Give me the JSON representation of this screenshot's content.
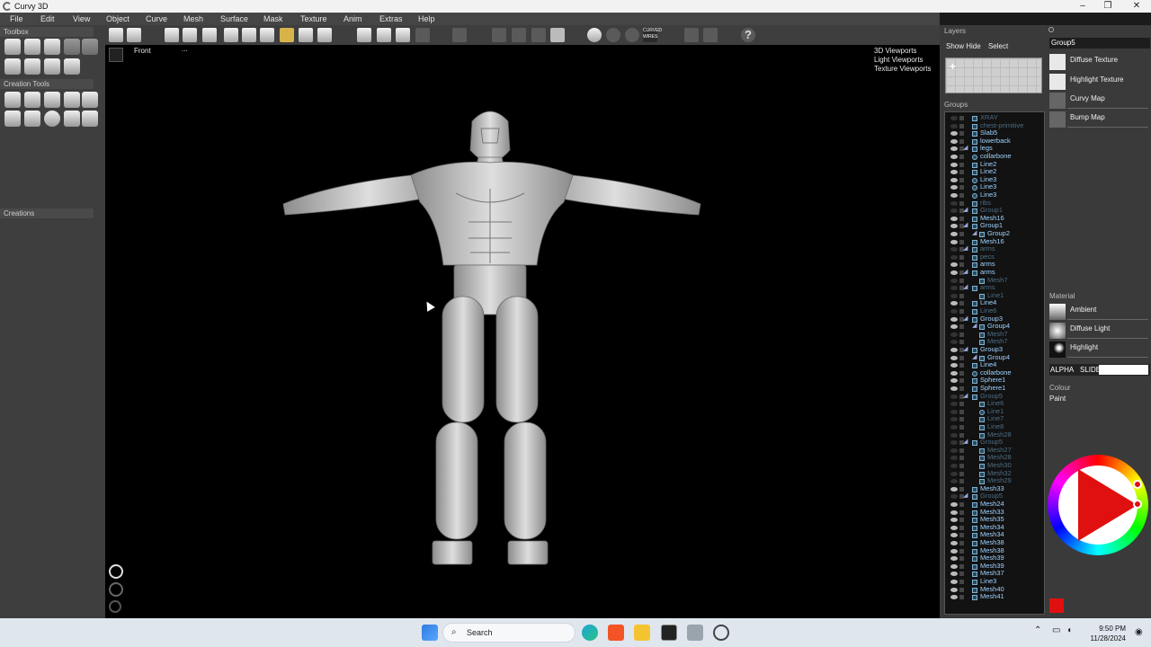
{
  "window": {
    "title": "Curvy 3D",
    "controls": [
      "–",
      "❐",
      "✕"
    ]
  },
  "menu": [
    "File",
    "Edit",
    "View",
    "Object",
    "Curve",
    "Mesh",
    "Surface",
    "Mask",
    "Texture",
    "Anim",
    "Extras",
    "Help"
  ],
  "left_panel": {
    "toolbox": "Toolbox",
    "creation_tools": "Creation Tools",
    "creations": "Creations"
  },
  "toolbar": {
    "curved_wires": "CURVED WIRES",
    "help": "?"
  },
  "viewport": {
    "name": "Front",
    "dots": "...",
    "links": [
      "3D Viewports",
      "Light Viewports",
      "Texture Viewports"
    ]
  },
  "layers": {
    "title": "Layers",
    "show": "Show",
    "hide": "Hide",
    "select": "Select",
    "groups_label": "Groups",
    "rows": [
      {
        "label": "XRAY",
        "visible": false,
        "indent": 1,
        "kind": "mesh"
      },
      {
        "label": "chest-primitive",
        "visible": false,
        "indent": 1,
        "kind": "mesh"
      },
      {
        "label": "Slab5",
        "visible": true,
        "indent": 1,
        "kind": "mesh"
      },
      {
        "label": "lowerback",
        "visible": true,
        "indent": 1,
        "kind": "mesh"
      },
      {
        "label": "legs",
        "visible": true,
        "indent": 1,
        "kind": "group"
      },
      {
        "label": "collarbone",
        "visible": true,
        "indent": 1,
        "kind": "line"
      },
      {
        "label": "Line2",
        "visible": true,
        "indent": 1,
        "kind": "mesh"
      },
      {
        "label": "Line2",
        "visible": true,
        "indent": 1,
        "kind": "mesh"
      },
      {
        "label": "Line3",
        "visible": true,
        "indent": 1,
        "kind": "line"
      },
      {
        "label": "Line3",
        "visible": true,
        "indent": 1,
        "kind": "line"
      },
      {
        "label": "Line3",
        "visible": true,
        "indent": 1,
        "kind": "line"
      },
      {
        "label": "ribs",
        "visible": false,
        "indent": 1,
        "kind": "mesh"
      },
      {
        "label": "Group1",
        "visible": false,
        "indent": 1,
        "kind": "group"
      },
      {
        "label": "Mesh16",
        "visible": true,
        "indent": 1,
        "kind": "mesh"
      },
      {
        "label": "Group1",
        "visible": true,
        "indent": 1,
        "kind": "group"
      },
      {
        "label": "Group2",
        "visible": true,
        "indent": 2,
        "kind": "group"
      },
      {
        "label": "Mesh16",
        "visible": true,
        "indent": 1,
        "kind": "mesh"
      },
      {
        "label": "arms",
        "visible": false,
        "indent": 1,
        "kind": "group"
      },
      {
        "label": "pecs",
        "visible": false,
        "indent": 1,
        "kind": "mesh"
      },
      {
        "label": "arms",
        "visible": true,
        "indent": 1,
        "kind": "mesh"
      },
      {
        "label": "arms",
        "visible": true,
        "indent": 1,
        "kind": "group"
      },
      {
        "label": "Mesh7",
        "visible": false,
        "indent": 2,
        "kind": "mesh"
      },
      {
        "label": "arms",
        "visible": false,
        "indent": 1,
        "kind": "group"
      },
      {
        "label": "Line1",
        "visible": false,
        "indent": 2,
        "kind": "mesh"
      },
      {
        "label": "Line4",
        "visible": true,
        "indent": 1,
        "kind": "mesh"
      },
      {
        "label": "Line6",
        "visible": false,
        "indent": 1,
        "kind": "mesh"
      },
      {
        "label": "Group3",
        "visible": true,
        "indent": 1,
        "kind": "group"
      },
      {
        "label": "Group4",
        "visible": true,
        "indent": 2,
        "kind": "group"
      },
      {
        "label": "Mesh7",
        "visible": false,
        "indent": 2,
        "kind": "mesh"
      },
      {
        "label": "Mesh7",
        "visible": false,
        "indent": 2,
        "kind": "mesh"
      },
      {
        "label": "Group3",
        "visible": true,
        "indent": 1,
        "kind": "group"
      },
      {
        "label": "Group4",
        "visible": true,
        "indent": 2,
        "kind": "group"
      },
      {
        "label": "Line4",
        "visible": true,
        "indent": 1,
        "kind": "mesh"
      },
      {
        "label": "collarbone",
        "visible": true,
        "indent": 1,
        "kind": "line"
      },
      {
        "label": "Sphere1",
        "visible": true,
        "indent": 1,
        "kind": "mesh"
      },
      {
        "label": "Sphere1",
        "visible": true,
        "indent": 1,
        "kind": "mesh"
      },
      {
        "label": "Group5",
        "visible": false,
        "indent": 1,
        "kind": "group"
      },
      {
        "label": "Line6",
        "visible": false,
        "indent": 2,
        "kind": "mesh"
      },
      {
        "label": "Line1",
        "visible": false,
        "indent": 2,
        "kind": "line"
      },
      {
        "label": "Line7",
        "visible": false,
        "indent": 2,
        "kind": "mesh"
      },
      {
        "label": "Line8",
        "visible": false,
        "indent": 2,
        "kind": "mesh"
      },
      {
        "label": "Mesh28",
        "visible": false,
        "indent": 2,
        "kind": "mesh"
      },
      {
        "label": "Group5",
        "visible": false,
        "indent": 1,
        "kind": "group"
      },
      {
        "label": "Mesh27",
        "visible": false,
        "indent": 2,
        "kind": "mesh"
      },
      {
        "label": "Mesh28",
        "visible": false,
        "indent": 2,
        "kind": "mesh"
      },
      {
        "label": "Mesh30",
        "visible": false,
        "indent": 2,
        "kind": "mesh"
      },
      {
        "label": "Mesh32",
        "visible": false,
        "indent": 2,
        "kind": "mesh"
      },
      {
        "label": "Mesh29",
        "visible": false,
        "indent": 2,
        "kind": "mesh"
      },
      {
        "label": "Mesh33",
        "visible": true,
        "indent": 1,
        "kind": "mesh"
      },
      {
        "label": "Group5",
        "visible": false,
        "indent": 1,
        "kind": "group"
      },
      {
        "label": "Mesh24",
        "visible": true,
        "indent": 1,
        "kind": "mesh"
      },
      {
        "label": "Mesh33",
        "visible": true,
        "indent": 1,
        "kind": "mesh"
      },
      {
        "label": "Mesh35",
        "visible": true,
        "indent": 1,
        "kind": "mesh"
      },
      {
        "label": "Mesh34",
        "visible": true,
        "indent": 1,
        "kind": "mesh"
      },
      {
        "label": "Mesh34",
        "visible": true,
        "indent": 1,
        "kind": "mesh"
      },
      {
        "label": "Mesh38",
        "visible": true,
        "indent": 1,
        "kind": "mesh"
      },
      {
        "label": "Mesh38",
        "visible": true,
        "indent": 1,
        "kind": "mesh"
      },
      {
        "label": "Mesh39",
        "visible": true,
        "indent": 1,
        "kind": "mesh"
      },
      {
        "label": "Mesh39",
        "visible": true,
        "indent": 1,
        "kind": "mesh"
      },
      {
        "label": "Mesh37",
        "visible": true,
        "indent": 1,
        "kind": "mesh"
      },
      {
        "label": "Line3",
        "visible": true,
        "indent": 1,
        "kind": "mesh"
      },
      {
        "label": "Mesh40",
        "visible": true,
        "indent": 1,
        "kind": "mesh"
      },
      {
        "label": "Mesh41",
        "visible": true,
        "indent": 1,
        "kind": "mesh"
      }
    ]
  },
  "properties": {
    "group_name": "Group5",
    "textures": [
      "Diffuse Texture",
      "Highlight Texture",
      "Curvy Map",
      "Bump Map"
    ],
    "material_label": "Material",
    "material": [
      "Ambient",
      "Diffuse Light",
      "Highlight"
    ],
    "alpha": "ALPHA",
    "slide": "SLIDE",
    "colour_label": "Colour",
    "paint": "Paint",
    "active_color": "#e01010",
    "wheel_fill_color": "#e01010"
  },
  "taskbar": {
    "search": "Search",
    "time": "9:50 PM",
    "date": "11/28/2024"
  }
}
